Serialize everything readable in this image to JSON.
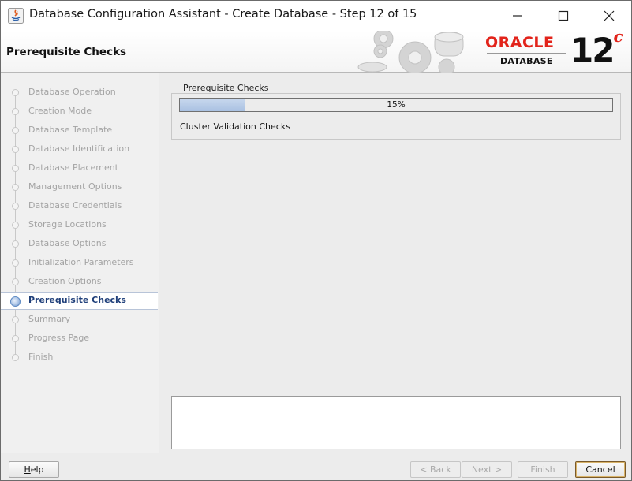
{
  "window": {
    "title": "Database Configuration Assistant - Create Database - Step 12 of 15"
  },
  "header": {
    "title": "Prerequisite Checks",
    "logo": {
      "brand": "ORACLE",
      "product": "DATABASE",
      "version": "12",
      "version_suffix": "c",
      "brand_color": "#e2231a"
    }
  },
  "sidebar": {
    "items": [
      {
        "label": "Database Operation",
        "state": "disabled"
      },
      {
        "label": "Creation Mode",
        "state": "disabled"
      },
      {
        "label": "Database Template",
        "state": "disabled"
      },
      {
        "label": "Database Identification",
        "state": "disabled"
      },
      {
        "label": "Database Placement",
        "state": "disabled"
      },
      {
        "label": "Management Options",
        "state": "disabled"
      },
      {
        "label": "Database Credentials",
        "state": "disabled"
      },
      {
        "label": "Storage Locations",
        "state": "disabled"
      },
      {
        "label": "Database Options",
        "state": "disabled"
      },
      {
        "label": "Initialization Parameters",
        "state": "disabled"
      },
      {
        "label": "Creation Options",
        "state": "disabled"
      },
      {
        "label": "Prerequisite Checks",
        "state": "active"
      },
      {
        "label": "Summary",
        "state": "disabled"
      },
      {
        "label": "Progress Page",
        "state": "disabled"
      },
      {
        "label": "Finish",
        "state": "disabled"
      }
    ]
  },
  "main": {
    "group_title": "Prerequisite Checks",
    "progress": {
      "percent": 15,
      "label": "15%"
    },
    "status": "Cluster Validation Checks",
    "details": ""
  },
  "buttons": {
    "help": "Help",
    "back": "< Back",
    "next": "Next >",
    "finish": "Finish",
    "cancel": "Cancel"
  },
  "icons": {
    "app": "java-dbca-icon",
    "minimize": "minimize-icon",
    "maximize": "maximize-icon",
    "close": "close-icon"
  }
}
